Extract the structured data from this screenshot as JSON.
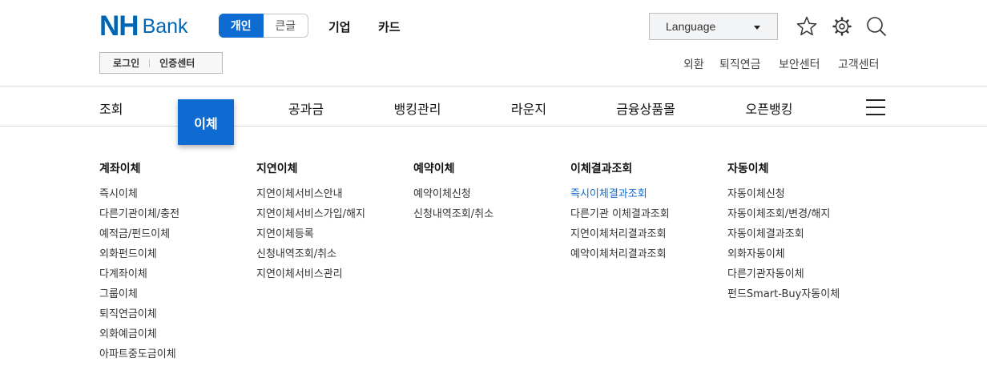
{
  "header": {
    "logo": {
      "nh": "NH",
      "bank": "Bank"
    },
    "segment": {
      "active": "개인",
      "inactive": "큰글"
    },
    "top_menu": [
      "기업",
      "카드"
    ],
    "language_label": "Language",
    "auth": {
      "login": "로그인",
      "cert": "인증센터"
    },
    "util_links": [
      "외환",
      "퇴직연금",
      "보안센터",
      "고객센터"
    ],
    "icons": [
      "star-icon",
      "gear-icon",
      "search-icon"
    ]
  },
  "gnb": {
    "items": [
      "조회",
      "이체",
      "공과금",
      "뱅킹관리",
      "라운지",
      "금융상품몰",
      "오픈뱅킹"
    ],
    "active": "이체"
  },
  "mega_menu": [
    {
      "title": "계좌이체",
      "links": [
        "즉시이체",
        "다른기관이체/충전",
        "예적금/펀드이체",
        "외화펀드이체",
        "다계좌이체",
        "그룹이체",
        "퇴직연금이체",
        "외화예금이체",
        "아파트중도금이체"
      ]
    },
    {
      "title": "지연이체",
      "links": [
        "지연이체서비스안내",
        "지연이체서비스가입/해지",
        "지연이체등록",
        "신청내역조회/취소",
        "지연이체서비스관리"
      ]
    },
    {
      "title": "예약이체",
      "links": [
        "예약이체신청",
        "신청내역조회/취소"
      ]
    },
    {
      "title": "이체결과조회",
      "links": [
        "즉시이체결과조회",
        "다른기관 이체결과조회",
        "지연이체처리결과조회",
        "예약이체처리결과조회"
      ],
      "selected": "즉시이체결과조회"
    },
    {
      "title": "자동이체",
      "links": [
        "자동이체신청",
        "자동이체조회/변경/해지",
        "자동이체결과조회",
        "외화자동이체",
        "다른기관자동이체",
        "펀드Smart-Buy자동이체"
      ]
    }
  ],
  "colors": {
    "brand": "#0066b3",
    "accent": "#0d6bd1"
  }
}
